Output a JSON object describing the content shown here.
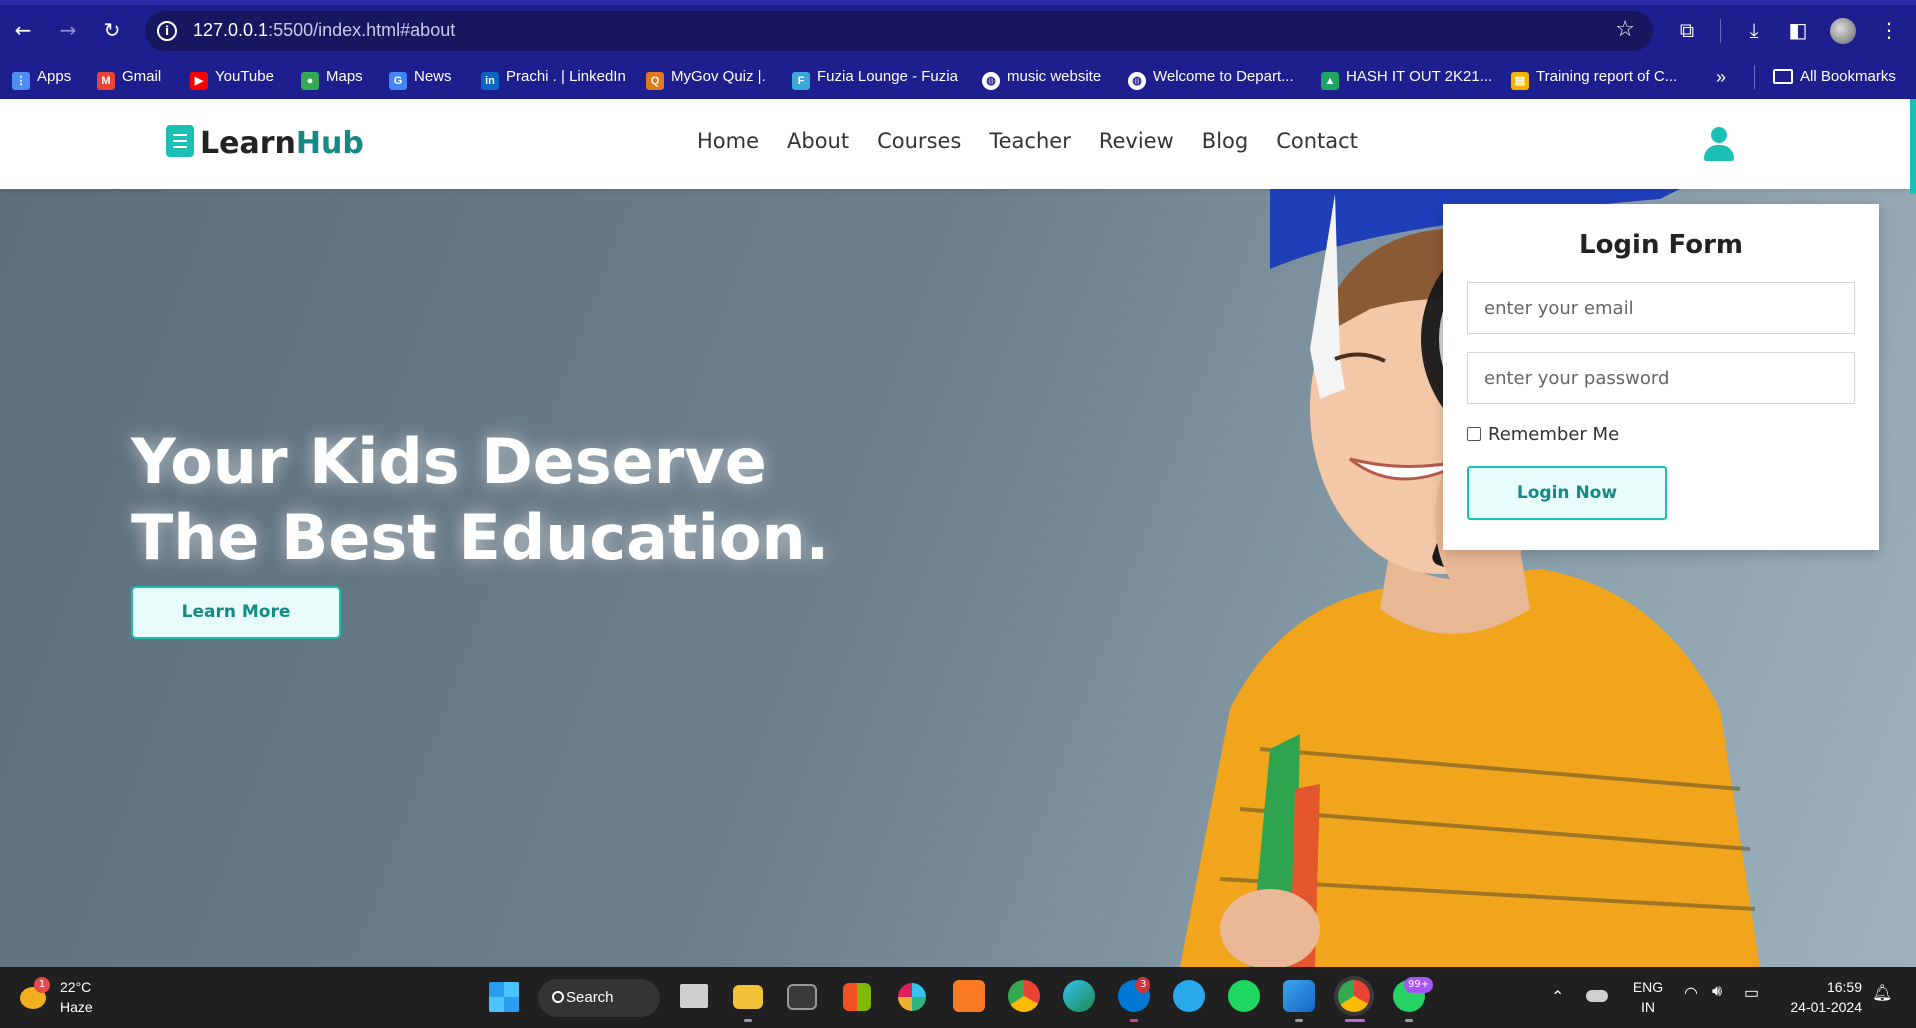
{
  "browser": {
    "url_host": "127.0.0.1",
    "url_rest": ":5500/index.html#about",
    "bookmarks": [
      {
        "label": "Apps",
        "color": "#4f8df5"
      },
      {
        "label": "Gmail",
        "color": "#ea4335"
      },
      {
        "label": "YouTube",
        "color": "#ff0000"
      },
      {
        "label": "Maps",
        "color": "#34a853"
      },
      {
        "label": "News",
        "color": "#4285f4"
      },
      {
        "label": "Prachi . | LinkedIn",
        "color": "#0a66c2"
      },
      {
        "label": "MyGov Quiz |.",
        "color": "#e07a1c"
      },
      {
        "label": "Fuzia Lounge - Fuzia",
        "color": "#3aa7d8"
      },
      {
        "label": "music website",
        "color": "#ffffff"
      },
      {
        "label": "Welcome to Depart...",
        "color": "#ffffff"
      },
      {
        "label": "HASH IT OUT 2K21...",
        "color": "#1fa463"
      },
      {
        "label": "Training report of C...",
        "color": "#f4b400"
      }
    ],
    "more_label": "»",
    "all_bookmarks": "All Bookmarks"
  },
  "site": {
    "logo_learn": "Learn",
    "logo_hub": "Hub",
    "accent_color": "#1bbfb3",
    "menu": [
      "Home",
      "About",
      "Courses",
      "Teacher",
      "Review",
      "Blog",
      "Contact"
    ]
  },
  "hero": {
    "title_line1": "Your Kids Deserve",
    "title_line2": "The Best Education.",
    "button": "Learn More"
  },
  "login": {
    "title": "Login Form",
    "email_placeholder": "enter your email",
    "password_placeholder": "enter your password",
    "remember": "Remember Me",
    "button": "Login Now"
  },
  "taskbar": {
    "weather_temp": "22°C",
    "weather_cond": "Haze",
    "weather_badge": "1",
    "search_label": "Search",
    "skype_badge": "3",
    "whatsapp_badge": "99+",
    "lang_top": "ENG",
    "lang_bottom": "IN",
    "time": "16:59",
    "date": "24-01-2024"
  }
}
